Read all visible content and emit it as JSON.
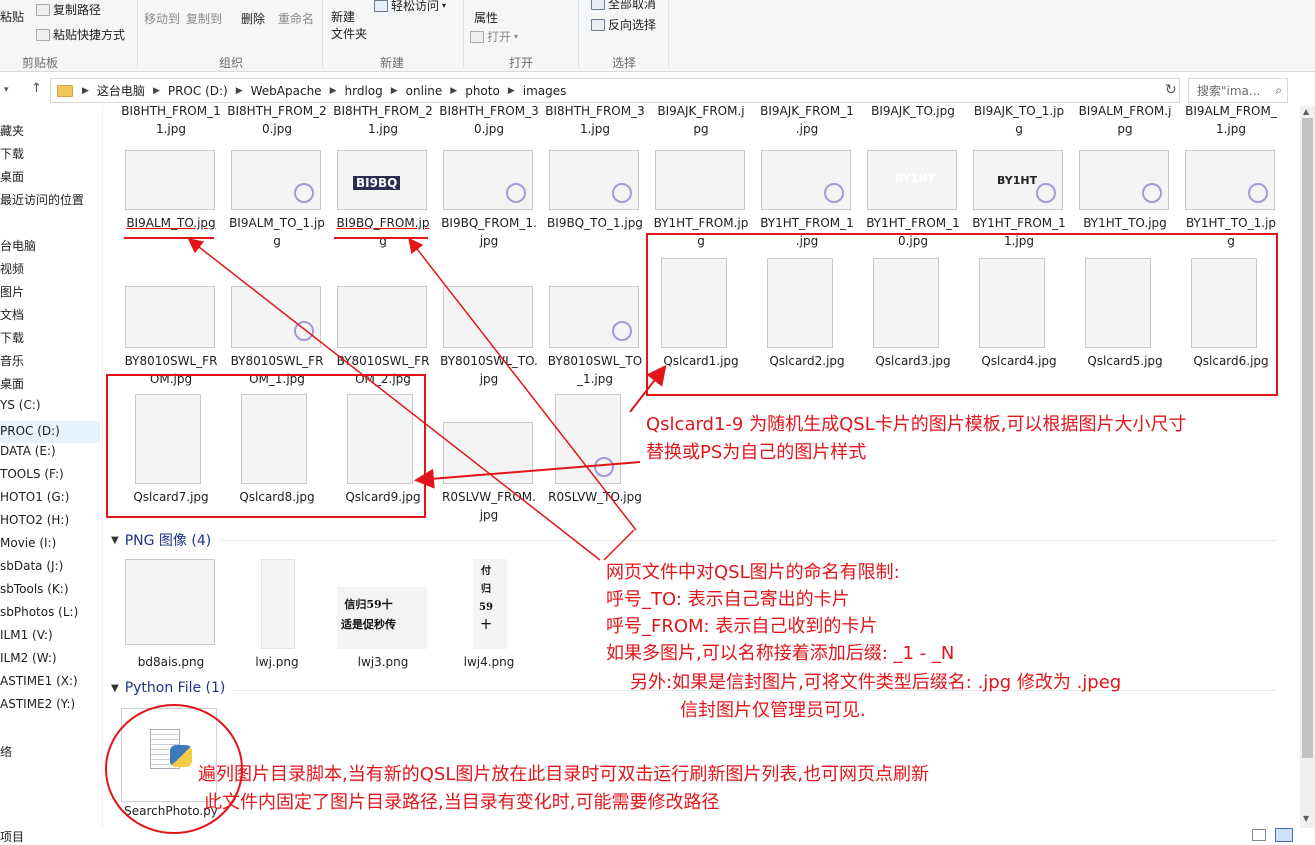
{
  "ribbon": {
    "paste": "粘贴",
    "copy_path": "复制路径",
    "paste_shortcut": "粘贴快捷方式",
    "clipboard_group": "剪贴板",
    "move_to": "移动到",
    "copy_to": "复制到",
    "delete": "删除",
    "rename": "重命名",
    "organize_group": "组织",
    "new_folder": "新建\n文件夹",
    "easy_access": "轻松访问",
    "new_group": "新建",
    "properties": "属性",
    "open": "打开",
    "open_group": "打开",
    "select_none": "全部取消",
    "invert_selection": "反向选择",
    "select_group": "选择"
  },
  "address": {
    "crumbs": [
      "这台电脑",
      "PROC (D:)",
      "WebApache",
      "hrdlog",
      "online",
      "photo",
      "images"
    ],
    "search_placeholder": "搜索\"ima..."
  },
  "nav": [
    "藏夹",
    "下载",
    "桌面",
    "最近访问的位置",
    "",
    "台电脑",
    "视频",
    "图片",
    "文档",
    "下载",
    "音乐",
    "桌面",
    "YS (C:)",
    "PROC (D:)",
    "DATA (E:)",
    "TOOLS (F:)",
    "HOTO1 (G:)",
    "HOTO2 (H:)",
    "Movie (I:)",
    "sbData (J:)",
    "sbTools (K:)",
    "sbPhotos (L:)",
    "ILM1 (V:)",
    "ILM2 (W:)",
    "ASTIME1 (X:)",
    "ASTIME2 (Y:)",
    "",
    "络"
  ],
  "status": {
    "items": "项目"
  },
  "files": {
    "row0": [
      "BI8HTH_FROM_1\n1.jpg",
      "BI8HTH_FROM_2\n0.jpg",
      "BI8HTH_FROM_2\n1.jpg",
      "BI8HTH_FROM_3\n0.jpg",
      "BI8HTH_FROM_3\n1.jpg",
      "BI9AJK_FROM.j\npg",
      "BI9AJK_FROM_1\n.jpg",
      "BI9AJK_TO.jpg",
      "BI9AJK_TO_1.jp\ng",
      "BI9ALM_FROM.j\npg",
      "BI9ALM_FROM_\n1.jpg"
    ],
    "row1": [
      "BI9ALM_TO.jpg",
      "BI9ALM_TO_1.jp\ng",
      "BI9BQ_FROM.jp\ng",
      "BI9BQ_FROM_1.\njpg",
      "BI9BQ_TO_1.jpg",
      "BY1HT_FROM.jp\ng",
      "BY1HT_FROM_1\n.jpg",
      "BY1HT_FROM_1\n0.jpg",
      "BY1HT_FROM_1\n1.jpg",
      "BY1HT_TO.jpg",
      "BY1HT_TO_1.jp\ng"
    ],
    "row2": [
      "BY8010SWL_FR\nOM.jpg",
      "BY8010SWL_FR\nOM_1.jpg",
      "BY8010SWL_FR\nOM_2.jpg",
      "BY8010SWL_TO.\njpg",
      "BY8010SWL_TO\n_1.jpg",
      "Qslcard1.jpg",
      "Qslcard2.jpg",
      "Qslcard3.jpg",
      "Qslcard4.jpg",
      "Qslcard5.jpg",
      "Qslcard6.jpg"
    ],
    "row3": [
      "Qslcard7.jpg",
      "Qslcard8.jpg",
      "Qslcard9.jpg",
      "R0SLVW_FROM.\njpg",
      "R0SLVW_TO.jpg"
    ]
  },
  "thumb_labels": {
    "bi9bq": "BI9BQ",
    "by1ht": "BY1HT",
    "calli1": "信归59十\n适是促秒传",
    "calli2": "付\n归\n59\n十"
  },
  "groups": {
    "png": "PNG 图像 (4)",
    "py": "Python File (1)"
  },
  "png_files": [
    "bd8ais.png",
    "lwj.png",
    "lwj3.png",
    "lwj4.png"
  ],
  "py_files": [
    "SearchPhoto.py"
  ],
  "annotations": {
    "qsl_note_1": "Qslcard1-9 为随机生成QSL卡片的图片模板,可以根据图片大小尺寸",
    "qsl_note_2": "替换或PS为自己的图片样式",
    "naming_1": "网页文件中对QSL图片的命名有限制:",
    "naming_2": "呼号_TO: 表示自己寄出的卡片",
    "naming_3": "呼号_FROM: 表示自己收到的卡片",
    "naming_4": "如果多图片,可以名称接着添加后缀:  _1 - _N",
    "naming_5": "另外:如果是信封图片,可将文件类型后缀名: .jpg 修改为 .jpeg",
    "naming_6": "信封图片仅管理员可见.",
    "script_1": "遍列图片目录脚本,当有新的QSL图片放在此目录时可双击运行刷新图片列表,也可网页点刷新",
    "script_2": "此文件内固定了图片目录路径,当目录有变化时,可能需要修改路径"
  },
  "colors": {
    "annotation": "#e2151b",
    "group_header": "#1e3287",
    "ribbon_bg": "#f5f6f7"
  },
  "icons": {
    "back": "back-arrow-icon",
    "up": "up-arrow-icon",
    "refresh": "refresh-icon",
    "search": "search-icon"
  }
}
